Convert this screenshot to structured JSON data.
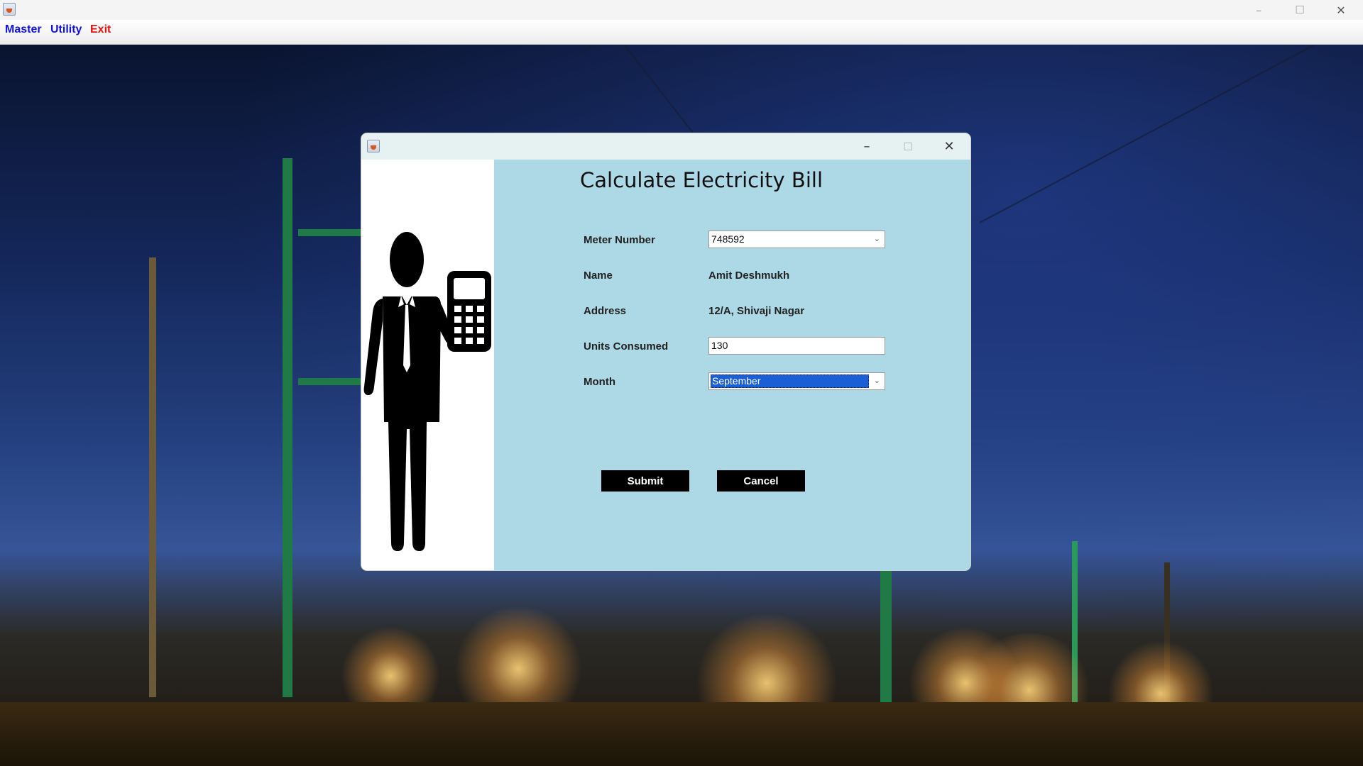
{
  "main_window": {
    "menu": [
      {
        "label": "Master",
        "color": "#1212d8"
      },
      {
        "label": "Utility",
        "color": "#1212d8"
      },
      {
        "label": "Exit",
        "color": "#e01010"
      }
    ],
    "controls": {
      "minimize": "–",
      "maximize": "☐",
      "close": "✕"
    }
  },
  "dialog": {
    "title": "Calculate Electricity Bill",
    "controls": {
      "minimize": "–",
      "maximize": "☐",
      "close": "✕"
    },
    "fields": {
      "meter_number": {
        "label": "Meter Number",
        "value": "748592"
      },
      "name": {
        "label": "Name",
        "value": "Amit Deshmukh"
      },
      "address": {
        "label": "Address",
        "value": "12/A, Shivaji Nagar"
      },
      "units_consumed": {
        "label": "Units Consumed",
        "value": "130"
      },
      "month": {
        "label": "Month",
        "value": "September"
      }
    },
    "buttons": {
      "submit": "Submit",
      "cancel": "Cancel"
    },
    "form_background": "#add8e6",
    "illustration": "man-with-calculator-icon"
  },
  "background_image": "power-substation-at-dusk"
}
